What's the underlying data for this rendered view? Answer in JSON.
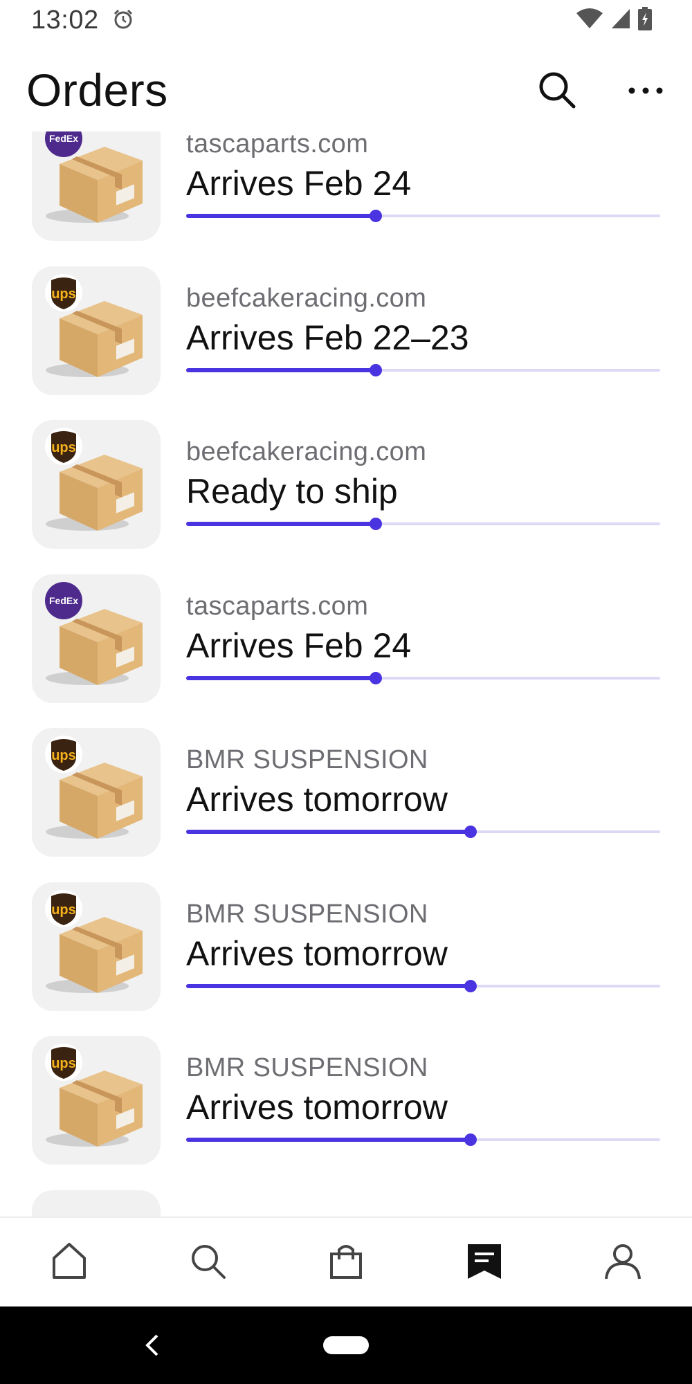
{
  "status_bar": {
    "time": "13:02",
    "icons": [
      "alarm-icon",
      "wifi-icon",
      "signal-icon",
      "battery-charging-icon"
    ]
  },
  "header": {
    "title": "Orders",
    "actions": [
      "search-icon",
      "more-icon"
    ]
  },
  "orders": [
    {
      "carrier": "FedEx",
      "merchant": "tascaparts.com",
      "status": "Arrives Feb 24",
      "progress": 0.4
    },
    {
      "carrier": "UPS",
      "merchant": "beefcakeracing.com",
      "status": "Arrives Feb 22–23",
      "progress": 0.4
    },
    {
      "carrier": "UPS",
      "merchant": "beefcakeracing.com",
      "status": "Ready to ship",
      "progress": 0.4
    },
    {
      "carrier": "FedEx",
      "merchant": "tascaparts.com",
      "status": "Arrives Feb 24",
      "progress": 0.4
    },
    {
      "carrier": "UPS",
      "merchant": "BMR SUSPENSION",
      "status": "Arrives tomorrow",
      "progress": 0.6
    },
    {
      "carrier": "UPS",
      "merchant": "BMR SUSPENSION",
      "status": "Arrives tomorrow",
      "progress": 0.6
    },
    {
      "carrier": "UPS",
      "merchant": "BMR SUSPENSION",
      "status": "Arrives tomorrow",
      "progress": 0.6
    }
  ],
  "bottom_nav": {
    "items": [
      "home-icon",
      "search-icon",
      "shopping-bag-icon",
      "orders-icon",
      "profile-icon"
    ],
    "active": "orders-icon"
  },
  "colors": {
    "accent": "#4a33e0",
    "track": "#ddd8f6",
    "fedex": "#4d2a8c",
    "ups_brown": "#3b2312",
    "ups_gold": "#f5b21b"
  }
}
